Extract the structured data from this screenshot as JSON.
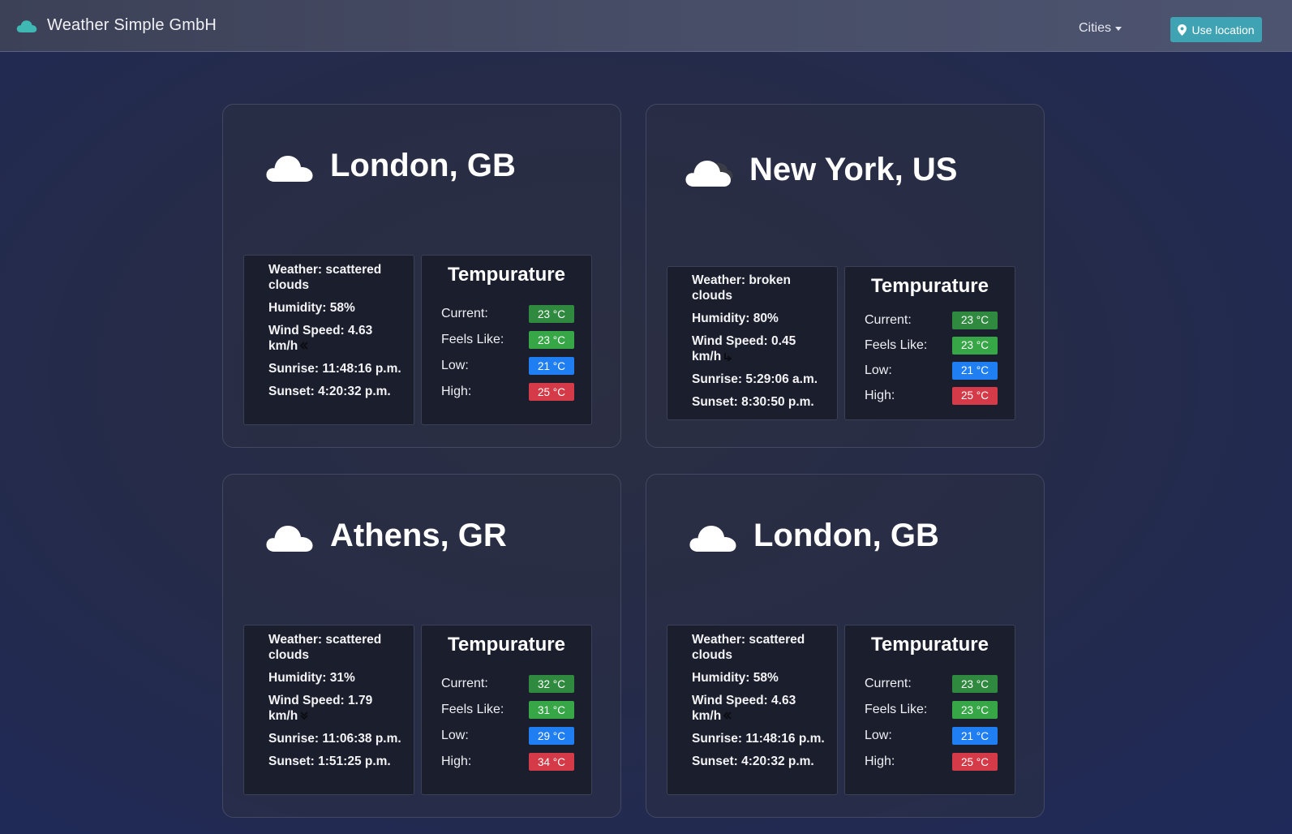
{
  "navbar": {
    "brand": "Weather Simple GmbH",
    "brand_icon": "cloud-icon",
    "cities_label": "Cities",
    "location_button": "Use location",
    "location_icon": "map-pin-icon",
    "accent_color": "#3fa3b3"
  },
  "temp_title": "Tempurature",
  "labels": {
    "current": "Current:",
    "feels": "Feels Like:",
    "low": "Low:",
    "high": "High:"
  },
  "cards": [
    {
      "city": "London, GB",
      "icon": "scattered-clouds-icon",
      "weather": "Weather: scattered clouds",
      "humidity": "Humidity: 58%",
      "wind": "Wind Speed: 4.63 km/h",
      "sunrise": "Sunrise: 11:48:16 p.m.",
      "sunset": "Sunset: 4:20:32 p.m.",
      "current": "23 °C",
      "feels": "23 °C",
      "low": "21 °C",
      "high": "25 °C"
    },
    {
      "city": "New York, US",
      "icon": "broken-clouds-icon",
      "weather": "Weather: broken clouds",
      "humidity": "Humidity: 80%",
      "wind": "Wind Speed: 0.45 km/h",
      "sunrise": "Sunrise: 5:29:06 a.m.",
      "sunset": "Sunset: 8:30:50 p.m.",
      "current": "23 °C",
      "feels": "23 °C",
      "low": "21 °C",
      "high": "25 °C"
    },
    {
      "city": "Athens, GR",
      "icon": "scattered-clouds-icon",
      "weather": "Weather: scattered clouds",
      "humidity": "Humidity: 31%",
      "wind": "Wind Speed: 1.79 km/h",
      "sunrise": "Sunrise: 11:06:38 p.m.",
      "sunset": "Sunset: 1:51:25 p.m.",
      "current": "32 °C",
      "feels": "31 °C",
      "low": "29 °C",
      "high": "34 °C"
    },
    {
      "city": "London, GB",
      "icon": "scattered-clouds-icon",
      "weather": "Weather: scattered clouds",
      "humidity": "Humidity: 58%",
      "wind": "Wind Speed: 4.63 km/h",
      "sunrise": "Sunrise: 11:48:16 p.m.",
      "sunset": "Sunset: 4:20:32 p.m.",
      "current": "23 °C",
      "feels": "23 °C",
      "low": "21 °C",
      "high": "25 °C"
    }
  ]
}
